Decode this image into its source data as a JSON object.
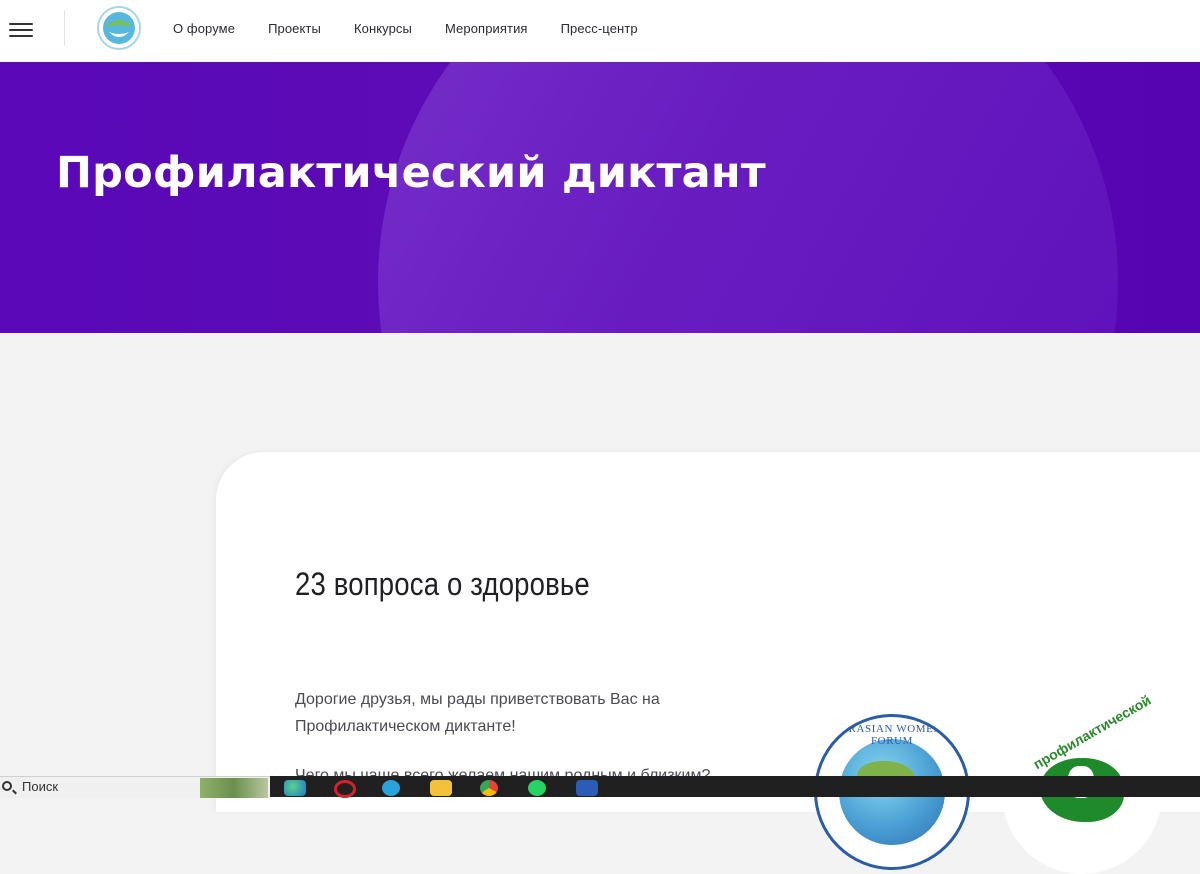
{
  "nav": {
    "items": [
      "О форуме",
      "Проекты",
      "Конкурсы",
      "Мероприятия",
      "Пресс-центр"
    ]
  },
  "hero": {
    "title": "Профилактический диктант"
  },
  "content": {
    "heading": "23 вопроса о здоровье",
    "paragraph1": "Дорогие друзья, мы рады приветствовать Вас на Профилактическом диктанте!",
    "paragraph2": "Чего мы чаще всего желаем нашим родным и близким?",
    "badge1_text": "EURASIAN WOMEN'S FORUM",
    "badge2_text": "профилактической"
  },
  "taskbar": {
    "search_label": "Поиск",
    "apps": [
      "edge-icon",
      "opera-icon",
      "telegram-icon",
      "file-explorer-icon",
      "chrome-icon",
      "whatsapp-icon",
      "word-icon"
    ]
  },
  "colors": {
    "hero": "#5a08b8",
    "accent_circle": "#7a35cc",
    "nav_text": "#2a2a33",
    "taskbar": "#202020"
  }
}
